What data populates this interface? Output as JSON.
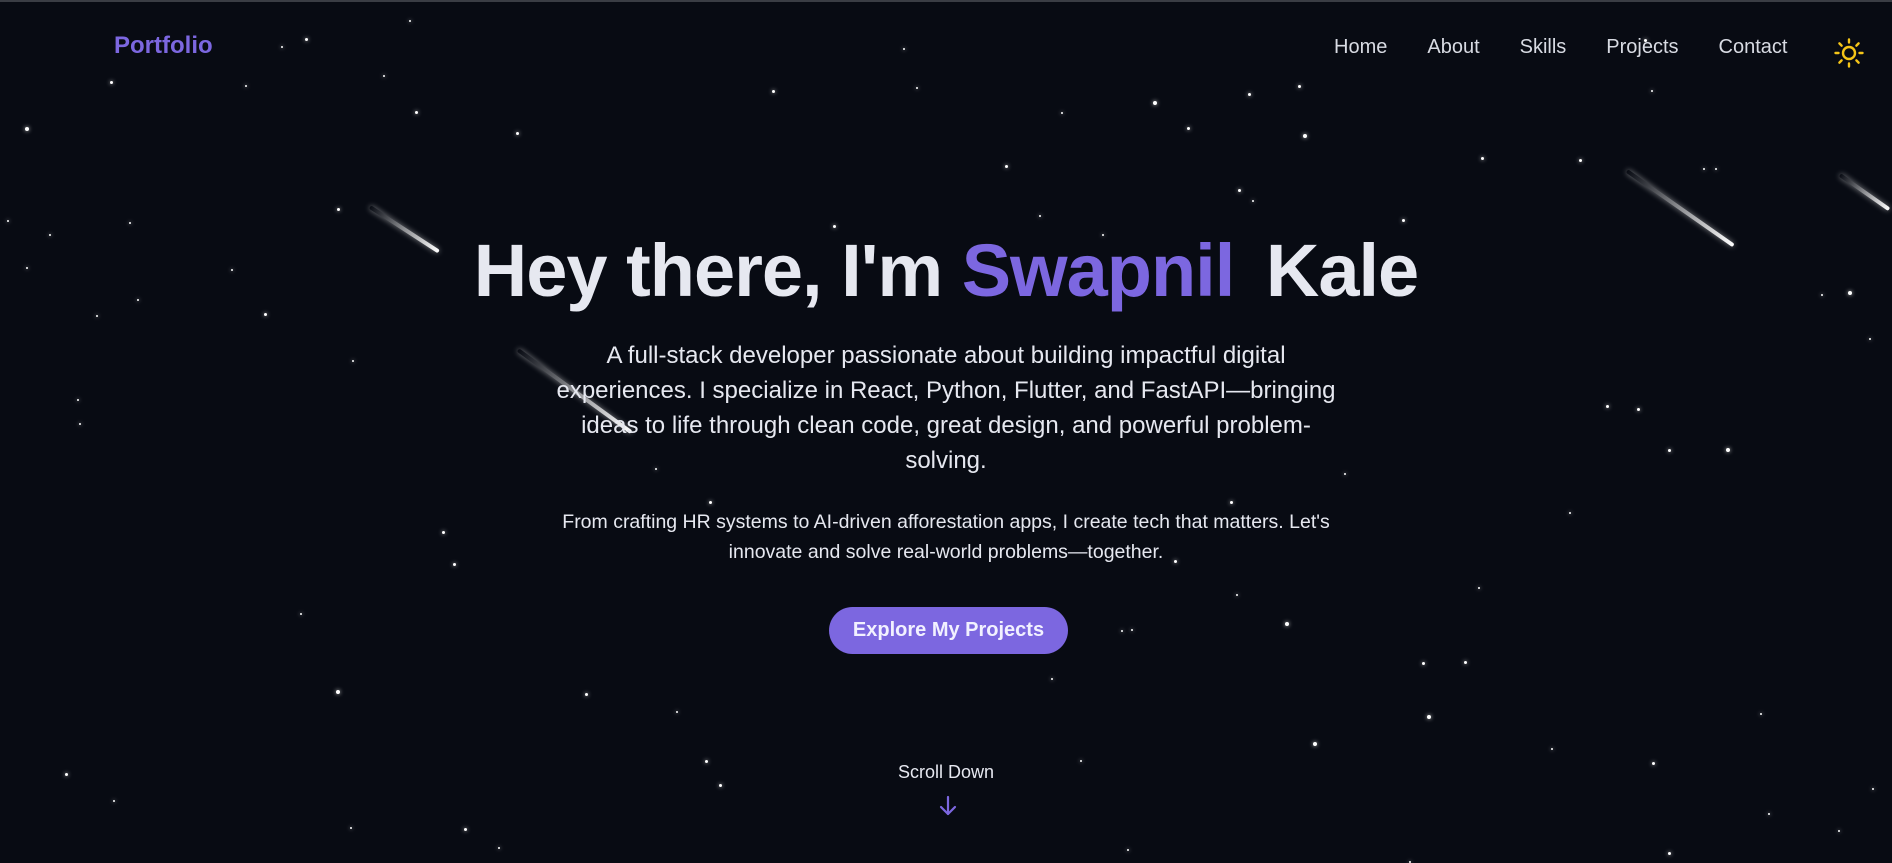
{
  "nav": {
    "brand": "Portfolio",
    "links": [
      "Home",
      "About",
      "Skills",
      "Projects",
      "Contact"
    ],
    "theme_toggle_icon": "sun-icon"
  },
  "hero": {
    "title_prefix": "Hey there, I'm",
    "first_name": "Swapnil",
    "last_name": "Kale",
    "description": "A full-stack developer passionate about building impactful digital experiences. I specialize in React, Python, Flutter, and FastAPI—bringing ideas to life through clean code, great design, and powerful problem-solving.",
    "secondary": "From crafting HR systems to AI-driven afforestation apps, I create tech that matters. Let's innovate and solve real-world problems—together.",
    "cta_label": "Explore My Projects"
  },
  "scroll": {
    "label": "Scroll Down",
    "icon": "arrow-down-icon"
  },
  "colors": {
    "background": "#080b13",
    "accent": "#7c67e0",
    "text": "#e6e8f0",
    "sun": "#f5c518"
  }
}
